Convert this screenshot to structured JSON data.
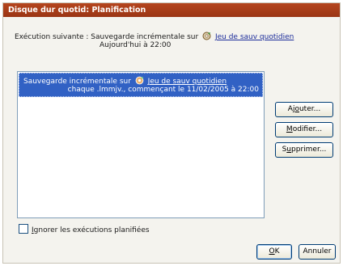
{
  "window": {
    "title": "Disque dur quotid: Planification"
  },
  "next_execution": {
    "prefix": "Exécution suivante : Sauvegarde incrémentale sur",
    "link": "Jeu de sauv quotidien",
    "time": "Aujourd'hui à 22:00",
    "icon": "backup-set-icon"
  },
  "schedule_list": {
    "items": [
      {
        "prefix": "Sauvegarde incrémentale sur",
        "link": "Jeu de sauv quotidien",
        "detail": "chaque .lmmjv., commençant le 11/02/2005 à 22:00",
        "icon": "backup-set-icon"
      }
    ]
  },
  "buttons": {
    "add": {
      "pre": "Aj",
      "key": "o",
      "post": "uter..."
    },
    "modify": {
      "pre": "",
      "key": "M",
      "post": "odifier..."
    },
    "delete": {
      "pre": "S",
      "key": "u",
      "post": "pprimer..."
    },
    "ok": {
      "pre": "",
      "key": "O",
      "post": "K"
    },
    "cancel": {
      "label": "Annuler"
    }
  },
  "ignore_checkbox": {
    "pre": "",
    "key": "I",
    "post": "gnorer les exécutions planifiées",
    "checked": false
  },
  "colors": {
    "titlebar": "#a43a16",
    "selection": "#3161c4",
    "link": "#1b2b9a"
  }
}
